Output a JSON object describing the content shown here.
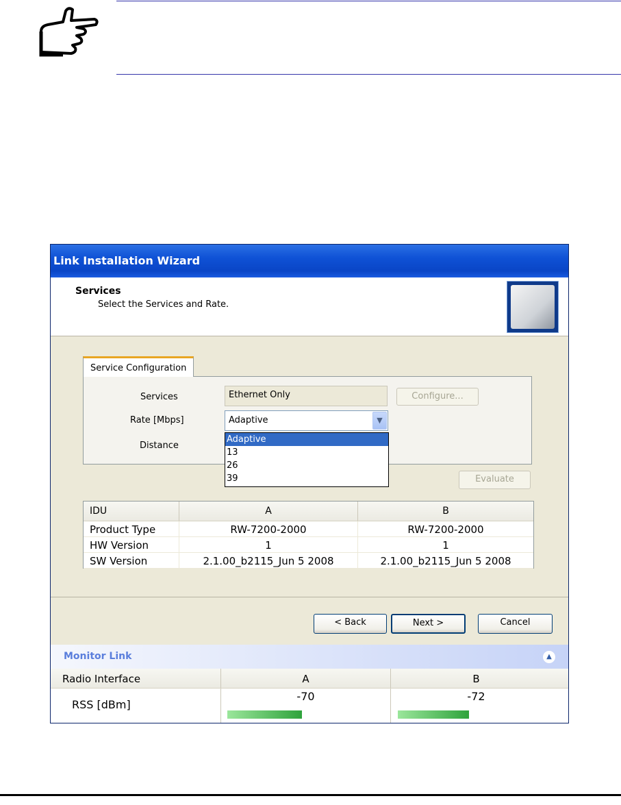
{
  "window": {
    "title": "Link Installation Wizard",
    "header_title": "Services",
    "header_subtitle": "Select the Services and Rate."
  },
  "service_config": {
    "tab_label": "Service Configuration",
    "services_label": "Services",
    "services_value": "Ethernet Only",
    "configure_label": "Configure...",
    "rate_label": "Rate [Mbps]",
    "rate_value": "Adaptive",
    "distance_label": "Distance",
    "rate_options": [
      "Adaptive",
      "13",
      "26",
      "39"
    ],
    "evaluate_label": "Evaluate"
  },
  "idu_table": {
    "headers": [
      "IDU",
      "A",
      "B"
    ],
    "rows": [
      [
        "Product Type",
        "RW-7200-2000",
        "RW-7200-2000"
      ],
      [
        "HW Version",
        "1",
        "1"
      ],
      [
        "SW Version",
        "2.1.00_b2115_Jun  5 2008",
        "2.1.00_b2115_Jun  5 2008"
      ]
    ]
  },
  "buttons": {
    "back": "< Back",
    "next": "Next >",
    "cancel": "Cancel"
  },
  "monitor": {
    "title": "Monitor Link",
    "headers": [
      "Radio Interface",
      "A",
      "B"
    ],
    "rss_label": "RSS [dBm]",
    "rss_a": "-70",
    "rss_b": "-72",
    "rss_a_level": 0.44,
    "rss_b_level": 0.42
  },
  "colors": {
    "title_bar": "#0a45c6",
    "selection": "#316ac5",
    "monitor_title": "#5a7edc",
    "rss_bar": "#2fa33c"
  }
}
